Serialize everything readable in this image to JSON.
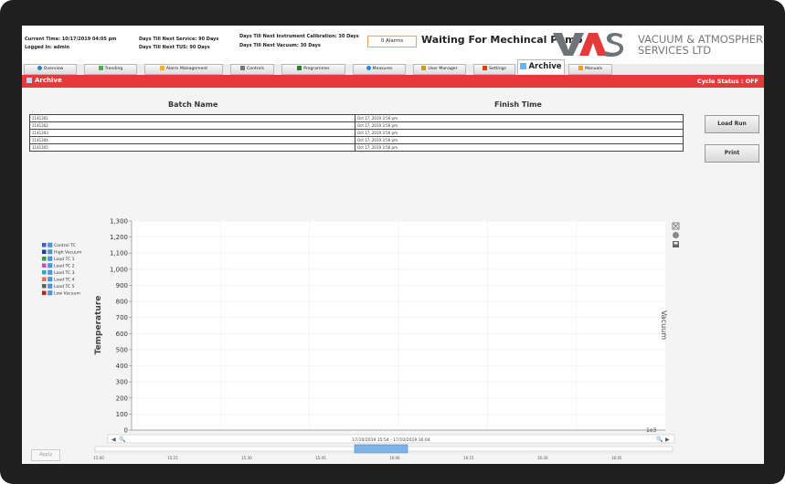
{
  "header": {
    "current_time": "Current Time: 10/17/2019 04:05 pm",
    "logged_in": "Logged In: admin",
    "service": "Days Till Next Service: 90 Days",
    "tus": "Days Till Next TUS: 90 Days",
    "calibration": "Days Till Next Instrument Calibration: 30 Days",
    "vacuum": "Days Till Next Vacuum: 30 Days",
    "alarms": "0 Alarms",
    "status_message": "Waiting For Mechincal Pump",
    "logo_text_line1": "VACUUM & ATMOSPHERE",
    "logo_text_line2": "SERVICES LTD",
    "logo_letters": "VAS"
  },
  "tabs": [
    {
      "label": "Overview",
      "icon": "overview-icon"
    },
    {
      "label": "Trending",
      "icon": "trending-icon"
    },
    {
      "label": "Alarm Management",
      "icon": "alarm-icon"
    },
    {
      "label": "Controls",
      "icon": "controls-icon"
    },
    {
      "label": "Programmer",
      "icon": "programmer-icon"
    },
    {
      "label": "Measures",
      "icon": "measures-icon"
    },
    {
      "label": "User Manager",
      "icon": "user-icon"
    },
    {
      "label": "Settings",
      "icon": "settings-icon"
    },
    {
      "label": "Archive",
      "icon": "archive-icon"
    },
    {
      "label": "Manuals",
      "icon": "manuals-icon"
    }
  ],
  "active_tab": "Archive",
  "page": {
    "title": "Archive",
    "cycle_status": "Cycle Status : OFF"
  },
  "table": {
    "headers": [
      "Batch Name",
      "Finish Time"
    ],
    "rows": [
      {
        "batch": "1141301",
        "finish": "Oct 17, 2019 3:56 pm"
      },
      {
        "batch": "1141302",
        "finish": "Oct 17, 2019 3:56 pm"
      },
      {
        "batch": "1141303",
        "finish": "Oct 17, 2019 3:56 pm"
      },
      {
        "batch": "1141304",
        "finish": "Oct 17, 2019 3:56 pm"
      },
      {
        "batch": "1141305",
        "finish": "Oct 17, 2019 3:56 pm"
      }
    ]
  },
  "buttons": {
    "load_run": "Load Run",
    "print": "Print",
    "apply": "Apply"
  },
  "chart": {
    "legend": [
      {
        "name": "Control TC",
        "color": "#3a5fcd"
      },
      {
        "name": "High Vacuum",
        "color": "#1f3f8f"
      },
      {
        "name": "Load TC 1",
        "color": "#2e9e3e"
      },
      {
        "name": "Load TC 2",
        "color": "#c04fc0"
      },
      {
        "name": "Load TC 3",
        "color": "#2fa8b8"
      },
      {
        "name": "Load TC 4",
        "color": "#e07050"
      },
      {
        "name": "Load TC 5",
        "color": "#606060"
      },
      {
        "name": "Low Vacuum",
        "color": "#c02020"
      }
    ],
    "y_label": "Temperature",
    "y2_label": "Vacuum",
    "y_ticks": [
      "0",
      "100",
      "200",
      "300",
      "400",
      "500",
      "600",
      "700",
      "800",
      "900",
      "1,000",
      "1,100",
      "1,200",
      "1,300"
    ],
    "y2_tick": "1e3",
    "range_label": "17/10/2019 15:54 - 17/10/2019 16:04",
    "nav_ticks": [
      "15:00",
      "15:15",
      "15:30",
      "15:45",
      "16:00",
      "16:15",
      "16:30",
      "16:45"
    ]
  }
}
